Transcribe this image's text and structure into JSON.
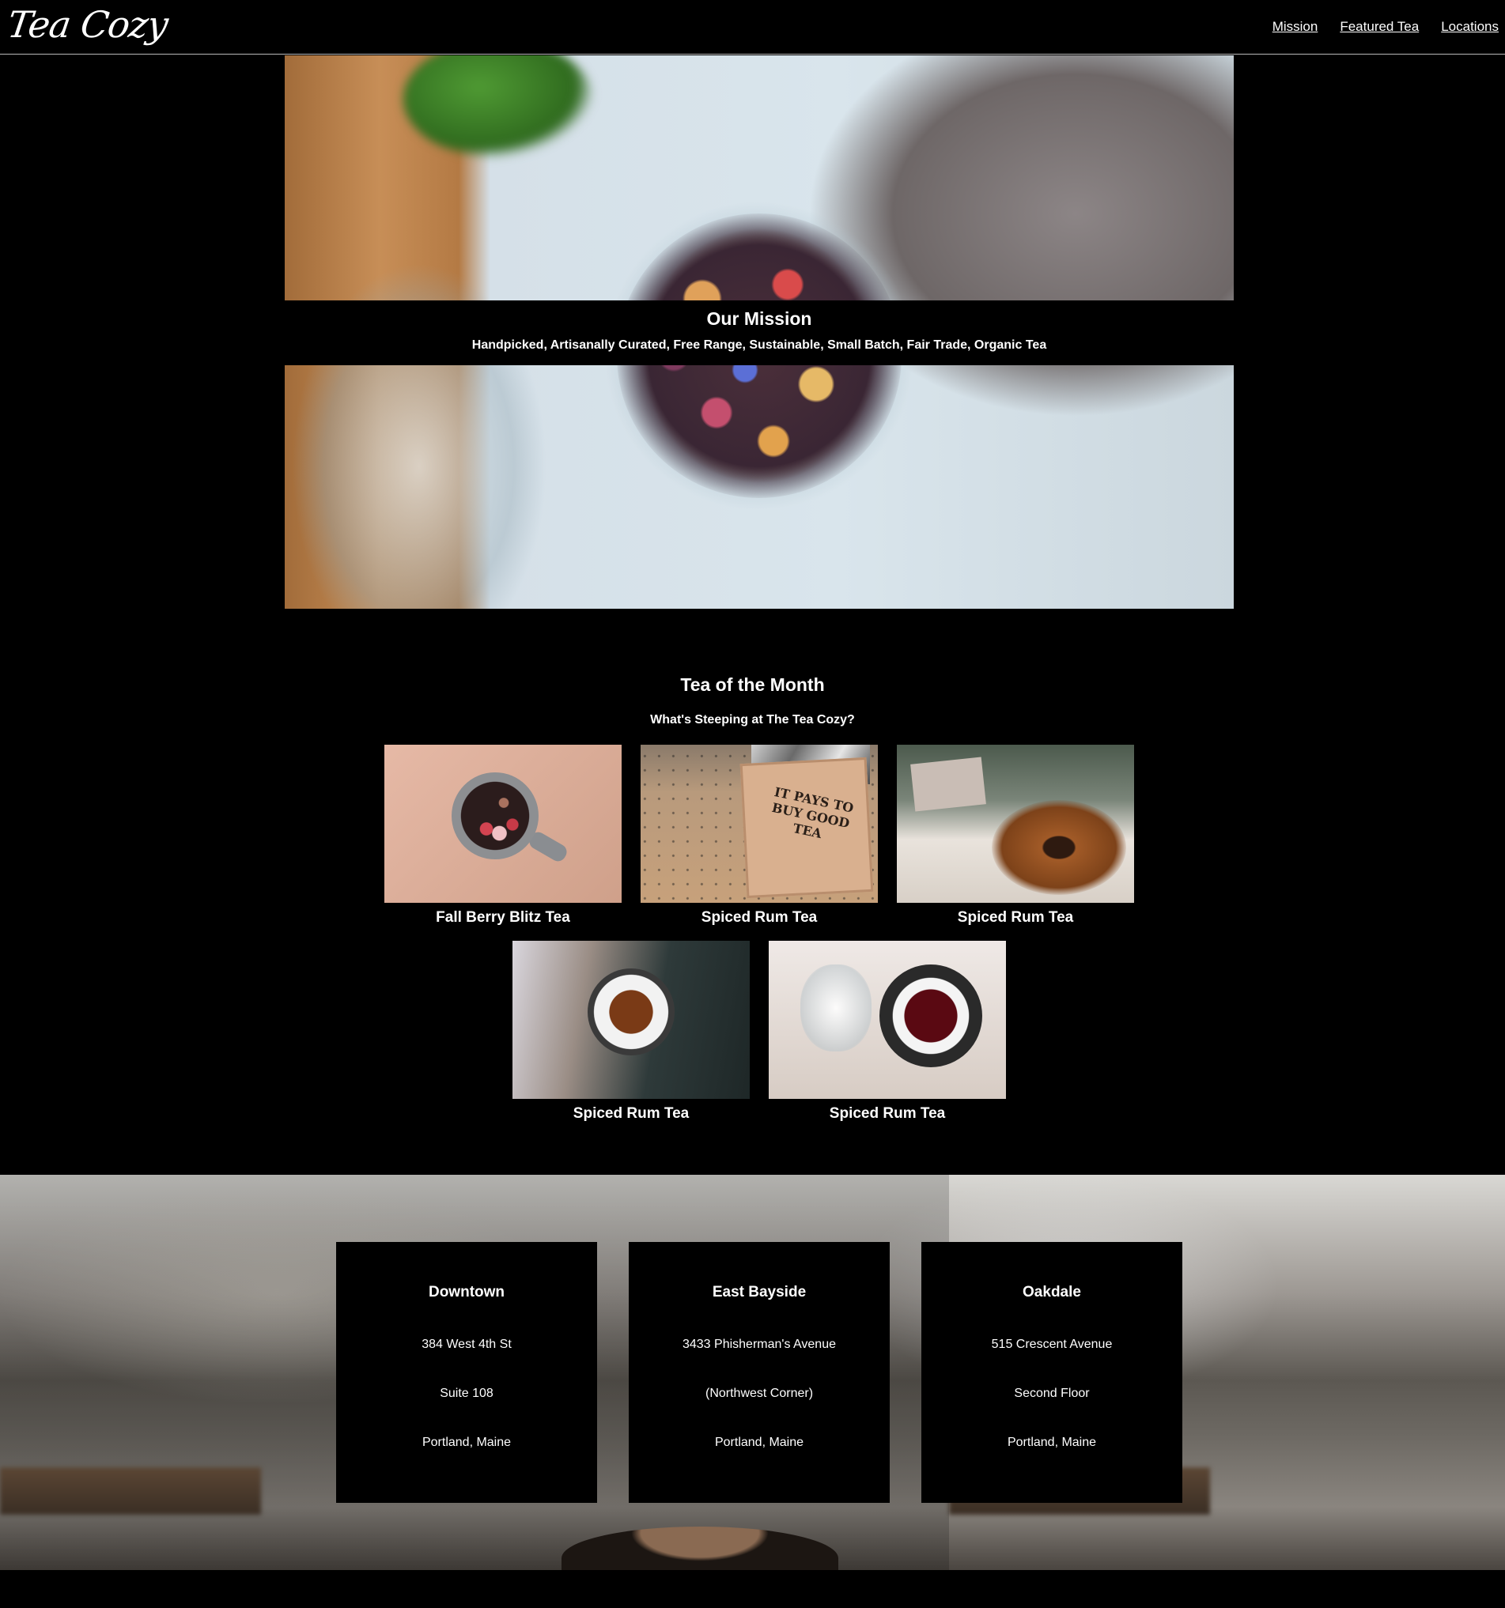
{
  "header": {
    "logo": "Tea Cozy",
    "nav": [
      {
        "label": "Mission"
      },
      {
        "label": "Featured Tea"
      },
      {
        "label": "Locations"
      }
    ]
  },
  "mission": {
    "title": "Our Mission",
    "subtitle": "Handpicked, Artisanally Curated, Free Range, Sustainable, Small Batch, Fair Trade, Organic Tea"
  },
  "featured": {
    "title": "Tea of the Month",
    "subtitle": "What's Steeping at The Tea Cozy?",
    "box_text": "IT PAYS TO BUY GOOD TEA",
    "teas": [
      {
        "name": "Fall Berry Blitz Tea"
      },
      {
        "name": "Spiced Rum Tea"
      },
      {
        "name": "Spiced Rum Tea"
      },
      {
        "name": "Spiced Rum Tea"
      },
      {
        "name": "Spiced Rum Tea"
      }
    ]
  },
  "locations": [
    {
      "name": "Downtown",
      "line1": "384 West 4th St",
      "line2": "Suite 108",
      "line3": "Portland, Maine"
    },
    {
      "name": "East Bayside",
      "line1": "3433 Phisherman's Avenue",
      "line2": "(Northwest Corner)",
      "line3": "Portland, Maine"
    },
    {
      "name": "Oakdale",
      "line1": "515 Crescent Avenue",
      "line2": "Second Floor",
      "line3": "Portland, Maine"
    }
  ]
}
